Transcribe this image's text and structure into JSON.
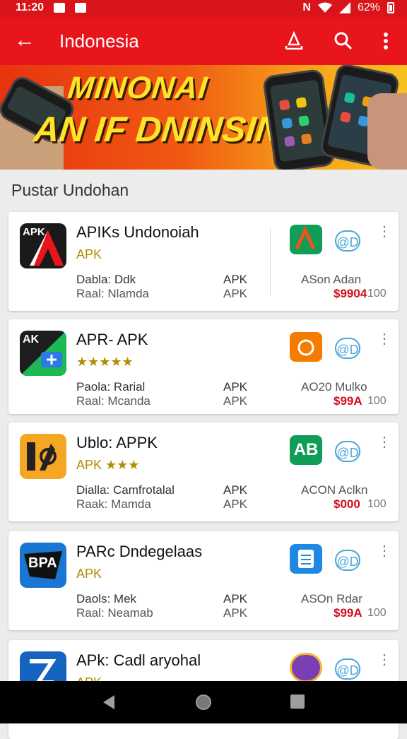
{
  "status": {
    "time": "11:20",
    "battery": "62%"
  },
  "appbar": {
    "title": "Indonesia"
  },
  "banner": {
    "line1": "MINONAI",
    "line2": "AN IF DNINSIN! .."
  },
  "section_title": "Pustar Undohan",
  "cards": [
    {
      "icon_text": "APK",
      "name": "APIKs Undonoiah",
      "sub": "APK",
      "meta1": "Dabla: Ddk",
      "meta2": "Raal: Nlamda",
      "apk1": "APK",
      "apk2": "APK",
      "install": "@D",
      "source": "ASon Adan",
      "price": "$9904",
      "price_suffix": "100"
    },
    {
      "icon_text": "AK",
      "name": "APR- APK",
      "sub": "★★★★★",
      "meta1": "Paola: Rarial",
      "meta2": "Raal: Mcanda",
      "apk1": "APK",
      "apk2": "APK",
      "install": "@D",
      "source": "AO20 Mulko",
      "price": "$99A",
      "price_suffix": "100"
    },
    {
      "icon_text": "",
      "name": "Ublo: APPK",
      "sub": "APK ★★★",
      "meta1": "Dialla: Camfrotalal",
      "meta2": "Raak: Mamda",
      "apk1": "APK",
      "apk2": "APK",
      "install": "@D",
      "source": "ACON Aclkn",
      "price": "$000",
      "price_suffix": "100"
    },
    {
      "icon_text": "BPA",
      "name": "PARc Dndegelaas",
      "sub": "APK",
      "meta1": "Daols: Mek",
      "meta2": "Raal: Neamab",
      "apk1": "APK",
      "apk2": "APK",
      "install": "@D",
      "source": "ASOn Rdar",
      "price": "$99A",
      "price_suffix": "100"
    },
    {
      "icon_text": "",
      "name": "APk: Cadl aryohal",
      "sub": "APK",
      "meta1": "",
      "meta2": "",
      "apk1": "",
      "apk2": "",
      "install": "@D",
      "source": "",
      "price": "",
      "price_suffix": ""
    }
  ],
  "colors": {
    "appbar": "#e8151c",
    "accent_blue": "#4aa6d8",
    "price_red": "#d30d1b"
  },
  "icons": [
    "back-arrow-icon",
    "share-icon",
    "search-icon",
    "more-vert-icon"
  ]
}
